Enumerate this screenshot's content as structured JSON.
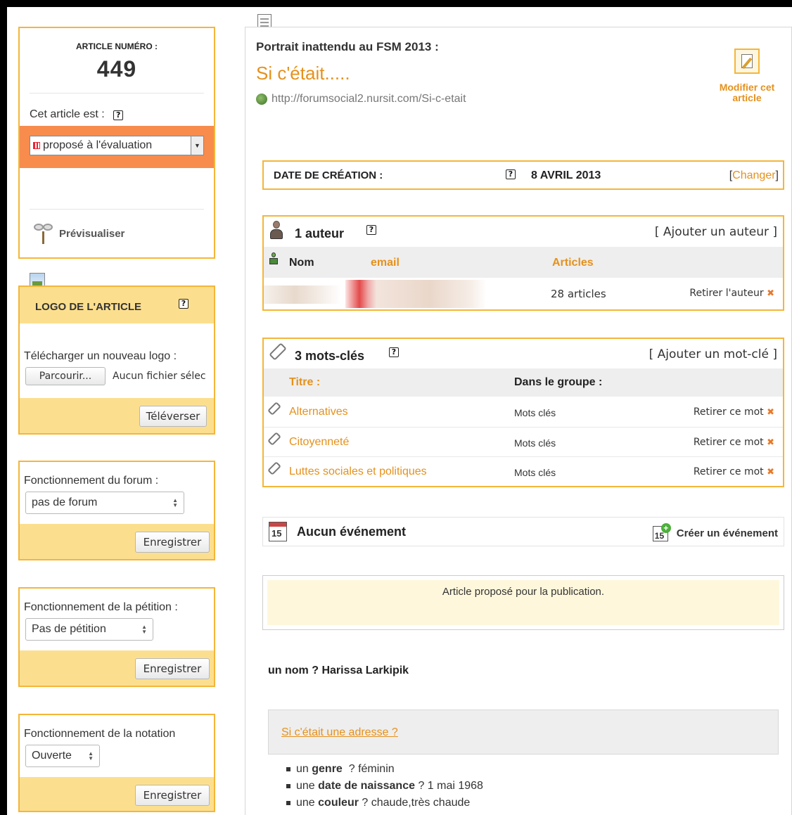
{
  "sidebar": {
    "article_box": {
      "label": "ARTICLE NUMÉRO :",
      "number": "449",
      "status_label": "Cet article est :",
      "status_value": "proposé à l'évaluation",
      "preview": "Prévisualiser"
    },
    "logo_box": {
      "title": "LOGO DE L'ARTICLE",
      "upload_label": "Télécharger un nouveau logo :",
      "browse_button": "Parcourir...",
      "no_file": "Aucun fichier sélec",
      "upload_button": "Téléverser"
    },
    "forum_box": {
      "label": "Fonctionnement du forum :",
      "value": "pas de forum",
      "save": "Enregistrer"
    },
    "petition_box": {
      "label": "Fonctionnement de la pétition :",
      "value": "Pas de pétition",
      "save": "Enregistrer"
    },
    "rating_box": {
      "label": "Fonctionnement de la notation",
      "value": "Ouverte",
      "save": "Enregistrer"
    }
  },
  "header": {
    "surtitle": "Portrait inattendu au FSM 2013 :",
    "title": "Si c'était.....",
    "url": "http://forumsocial2.nursit.com/Si-c-etait",
    "edit_label": "Modifier cet article"
  },
  "date_box": {
    "label": "DATE DE CRÉATION :",
    "value": "8 AVRIL 2013",
    "change": "Changer",
    "bracket_open": "[",
    "bracket_close": "]"
  },
  "authors": {
    "title": "1 auteur",
    "add": "[ Ajouter un auteur ]",
    "col_name": "Nom",
    "col_email": "email",
    "col_articles": "Articles",
    "rows": [
      {
        "articles": "28 articles",
        "remove": "Retirer l'auteur"
      }
    ]
  },
  "keywords": {
    "title": "3 mots-clés",
    "add": "[ Ajouter un mot-clé ]",
    "col_title": "Titre :",
    "col_group": "Dans le groupe :",
    "rows": [
      {
        "title": "Alternatives",
        "group": "Mots clés",
        "remove": "Retirer ce mot"
      },
      {
        "title": "Citoyenneté",
        "group": "Mots clés",
        "remove": "Retirer ce mot"
      },
      {
        "title": "Luttes sociales et politiques",
        "group": "Mots clés",
        "remove": "Retirer ce mot"
      }
    ]
  },
  "events": {
    "title": "Aucun événement",
    "create": "Créer un événement",
    "calendar_day": "15"
  },
  "notice": {
    "text": "Article proposé pour la publication."
  },
  "content": {
    "line1_q": "un nom ?",
    "line1_a": "Harissa Larkipik",
    "section_link": "Si c'était une adresse ?",
    "items": [
      {
        "pre": "un",
        "bold": "genre",
        "rest": "  ? féminin"
      },
      {
        "pre": "une",
        "bold": "date de naissance",
        "rest": " ? 1 mai 1968"
      },
      {
        "pre": "une",
        "bold": "couleur",
        "rest": " ? chaude,très chaude"
      }
    ]
  },
  "colors": {
    "accent_orange": "#e5911c",
    "box_border": "#f4b63a",
    "status_band": "#f78c4d",
    "band_yellow": "#fcdf8e"
  }
}
